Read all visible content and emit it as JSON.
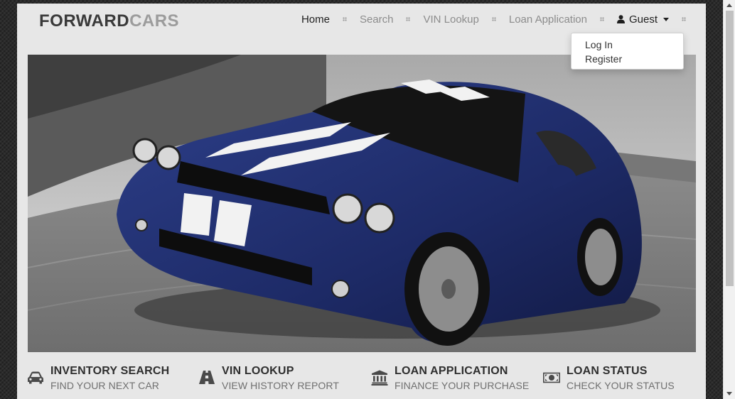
{
  "brand": {
    "part1": "FORWARD",
    "part2": "CARS"
  },
  "nav": {
    "items": [
      {
        "label": "Home",
        "active": true
      },
      {
        "label": "Search",
        "active": false
      },
      {
        "label": "VIN Lookup",
        "active": false
      },
      {
        "label": "Loan Application",
        "active": false
      }
    ],
    "user": {
      "label": "Guest",
      "icon": "user-icon"
    }
  },
  "dropdown": {
    "items": [
      "Log In",
      "Register"
    ]
  },
  "hero": {
    "image": "blue-muscle-car-photo"
  },
  "features": [
    {
      "icon": "car-icon",
      "title": "INVENTORY SEARCH",
      "subtitle": "FIND YOUR NEXT CAR"
    },
    {
      "icon": "road-icon",
      "title": "VIN LOOKUP",
      "subtitle": "VIEW HISTORY REPORT"
    },
    {
      "icon": "bank-icon",
      "title": "LOAN APPLICATION",
      "subtitle": "FINANCE YOUR PURCHASE"
    },
    {
      "icon": "money-icon",
      "title": "LOAN STATUS",
      "subtitle": "CHECK YOUR STATUS"
    }
  ],
  "colors": {
    "title": "#2f2f2f",
    "muted": "#8c8c8c",
    "page_bg": "#e7e7e7",
    "car": "#1f2f6e"
  }
}
